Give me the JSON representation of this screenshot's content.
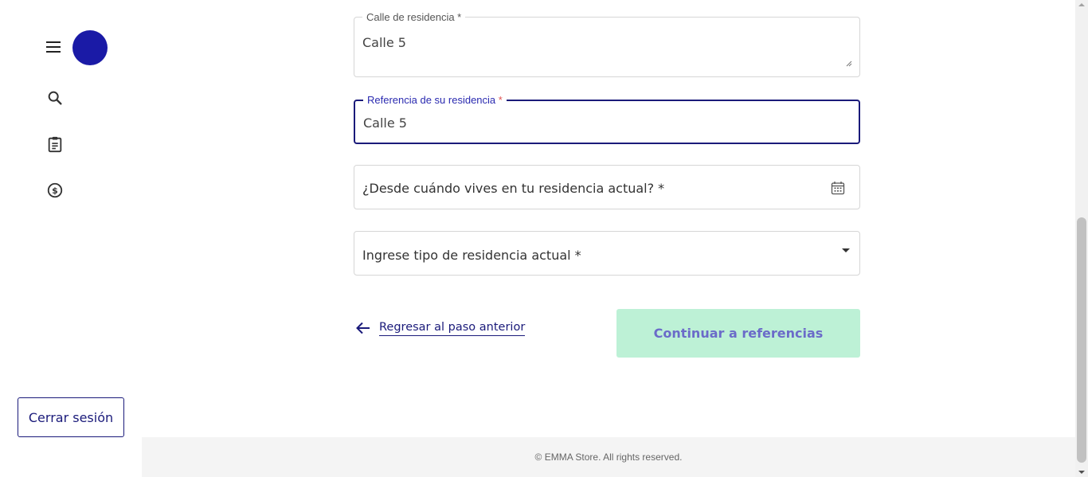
{
  "sidebar": {
    "menu_icon": "menu-icon",
    "avatar_color": "#1a1aa6",
    "items": [
      {
        "icon": "search-icon"
      },
      {
        "icon": "clipboard-icon"
      },
      {
        "icon": "dollar-icon"
      }
    ],
    "logout_label": "Cerrar sesión"
  },
  "form": {
    "street": {
      "label": "Calle de residencia *",
      "value": "Calle 5"
    },
    "reference": {
      "label": "Referencia de su residencia",
      "required_mark": "*",
      "value": "Calle 5"
    },
    "since": {
      "placeholder": "¿Desde cuándo vives en tu residencia actual? *",
      "icon": "calendar-icon"
    },
    "residence_type": {
      "placeholder": "Ingrese tipo de residencia actual *",
      "icon": "caret-down-icon"
    },
    "back_label": "Regresar al paso anterior",
    "continue_label": "Continuar a referencias"
  },
  "footer": {
    "copyright": "© EMMA Store. All rights reserved."
  },
  "colors": {
    "primary": "#1a1a7a",
    "continue_bg": "#bdf1d6",
    "continue_text": "#6b6bc9",
    "required_mark": "#e05555"
  }
}
